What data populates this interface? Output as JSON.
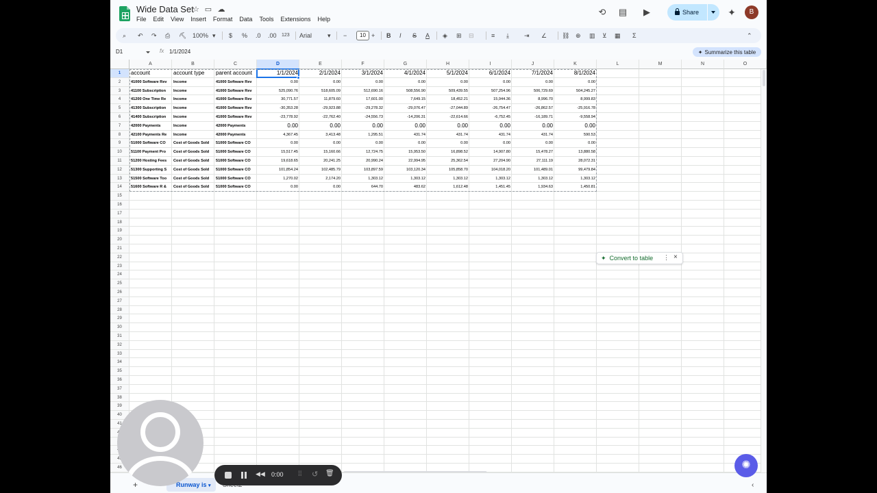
{
  "title": "Wide Data Set",
  "menu": [
    "File",
    "Edit",
    "View",
    "Insert",
    "Format",
    "Data",
    "Tools",
    "Extensions",
    "Help"
  ],
  "share_label": "Share",
  "avatar_letter": "B",
  "toolbar": {
    "zoom": "100%",
    "currency": "$",
    "percent": "%",
    "dec_less": ".0",
    "dec_more": ".00",
    "more_formats": "123",
    "font": "Arial",
    "font_size": "10",
    "bold": "B",
    "italic": "I",
    "strike": "S",
    "text_color": "A"
  },
  "formula_bar": {
    "name_box": "D1",
    "fx": "fx",
    "value": "1/1/2024",
    "summarize": "Summarize this table"
  },
  "columns": [
    "A",
    "B",
    "C",
    "D",
    "E",
    "F",
    "G",
    "H",
    "I",
    "J",
    "K",
    "L",
    "M",
    "N",
    "O"
  ],
  "header_row": [
    "account",
    "account type",
    "parent account",
    "1/1/2024",
    "2/1/2024",
    "3/1/2024",
    "4/1/2024",
    "5/1/2024",
    "6/1/2024",
    "7/1/2024",
    "8/1/2024"
  ],
  "rows": [
    [
      "41000 Software Rev",
      "Income",
      "41000 Software Rev",
      "0.00",
      "0.00",
      "0.00",
      "0.00",
      "0.00",
      "0.00",
      "0.00",
      "0.00"
    ],
    [
      "41100 Subscription",
      "Income",
      "41000 Software Rev",
      "525,090.76",
      "518,605.09",
      "512,690.16",
      "508,556.90",
      "509,439.55",
      "507,254.96",
      "506,729.69",
      "504,245.27"
    ],
    [
      "41200 One Time Re",
      "Income",
      "41000 Software Rev",
      "30,771.57",
      "11,879.60",
      "17,601.00",
      "7,649.15",
      "18,452.21",
      "15,944.36",
      "8,996.70",
      "8,999.83"
    ],
    [
      "41300 Subscription",
      "Income",
      "41000 Software Rev",
      "-30,353.28",
      "-29,923.88",
      "-29,278.32",
      "-29,076.47",
      "-27,044.89",
      "-26,754.47",
      "-26,862.57",
      "-25,916.78"
    ],
    [
      "41400 Subscription",
      "Income",
      "41000 Software Rev",
      "-23,778.92",
      "-22,762.40",
      "-24,556.73",
      "-14,206.31",
      "-22,614.66",
      "-6,752.45",
      "-16,189.71",
      "-9,558.94"
    ],
    [
      "42000 Payments",
      "Income",
      "42000 Payments",
      "0.00",
      "0.00",
      "0.00",
      "0.00",
      "0.00",
      "0.00",
      "0.00",
      "0.00"
    ],
    [
      "42100 Payments Re",
      "Income",
      "42000 Payments",
      "4,367.45",
      "3,413.48",
      "1,295.51",
      "431.74",
      "431.74",
      "431.74",
      "431.74",
      "590.53"
    ],
    [
      "51000 Software CO",
      "Cost of Goods Sold",
      "51000 Software CO",
      "0.00",
      "0.00",
      "0.00",
      "0.00",
      "0.00",
      "0.00",
      "0.00",
      "0.00"
    ],
    [
      "51100 Payment Pro",
      "Cost of Goods Sold",
      "51000 Software CO",
      "15,517.45",
      "15,160.66",
      "12,724.75",
      "15,953.50",
      "16,898.52",
      "14,907.80",
      "15,478.27",
      "13,880.58"
    ],
    [
      "51200 Hosting Fees",
      "Cost of Goods Sold",
      "51000 Software CO",
      "19,618.65",
      "20,241.25",
      "20,990.24",
      "22,994.95",
      "25,362.54",
      "27,204.90",
      "27,111.19",
      "28,072.31"
    ],
    [
      "51300 Supporting S",
      "Cost of Goods Sold",
      "51000 Software CO",
      "101,854.24",
      "102,485.79",
      "103,897.59",
      "103,120.34",
      "105,858.70",
      "104,018.20",
      "101,489.01",
      "99,479.84"
    ],
    [
      "51500 Software Too",
      "Cost of Goods Sold",
      "51000 Software CO",
      "1,270.02",
      "2,174.20",
      "1,303.12",
      "1,303.12",
      "1,303.12",
      "1,303.12",
      "1,303.12",
      "1,303.12"
    ],
    [
      "51600 Software R &",
      "Cost of Goods Sold",
      "51000 Software CO",
      "0.00",
      "0.00",
      "644.70",
      "483.62",
      "1,612.48",
      "1,451.45",
      "1,934.63",
      "1,450.81"
    ]
  ],
  "convert_chip": "Convert to table",
  "sheets": [
    "Runway is",
    "Sheet2"
  ],
  "recorder": {
    "time": "0:00"
  }
}
